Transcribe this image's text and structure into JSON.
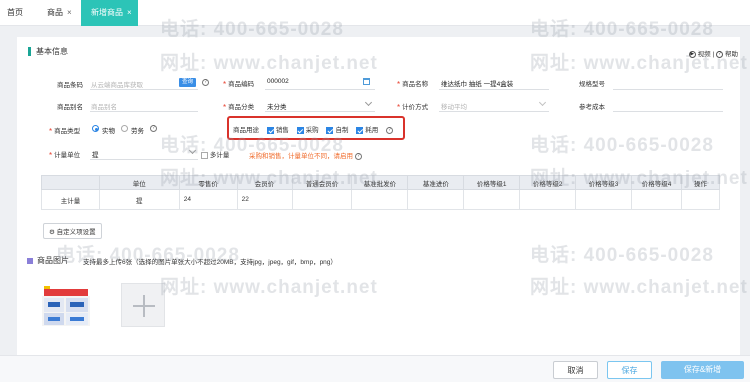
{
  "tabs": {
    "home": "首页",
    "goods": "商品",
    "new_goods": "新增商品",
    "close": "×"
  },
  "header": {
    "section_title": "基本信息",
    "video": "视频",
    "separator": "|",
    "help": "帮助"
  },
  "form": {
    "barcode_label": "商品条码",
    "barcode_placeholder": "从云端商品库获取",
    "query_button": "查询",
    "code_label": "商品编码",
    "code_value": "000002",
    "name_label": "商品名称",
    "name_value": "维达纸巾 抽纸 一提4盒装",
    "spec_label": "规格型号",
    "alias_label": "商品别名",
    "alias_placeholder": "商品别名",
    "category_label": "商品分类",
    "category_value": "未分类",
    "pricing_label": "计价方式",
    "pricing_value": "移动平均",
    "ref_cost_label": "参考成本",
    "type_label": "商品类型",
    "type_physical": "实物",
    "type_service": "劳务",
    "usage_label": "商品用途",
    "usage_options": [
      "销售",
      "采购",
      "自制",
      "耗用"
    ],
    "unit_label": "计量单位",
    "unit_value": "提",
    "multi_unit_label": "多计量",
    "warning": "采购和销售，计量单位不同，请启用"
  },
  "table": {
    "headers": [
      "",
      "单位",
      "零售价",
      "会员价",
      "普通会员价",
      "基准批发价",
      "基准进价",
      "价格等级1",
      "价格等级2",
      "价格等级3",
      "价格等级4",
      "操作"
    ],
    "rows": [
      [
        "主计量",
        "提",
        "24",
        "22",
        "",
        "",
        "",
        "",
        "",
        "",
        "",
        ""
      ]
    ]
  },
  "custom_button": "自定义项设置",
  "images": {
    "label": "商品图片",
    "hint": "支持最多上传6张（选择的图片单张大小不超过20MB，支持jpg，jpeg，gif，bmp，png）"
  },
  "footer": {
    "cancel": "取消",
    "save": "保存",
    "save_new": "保存&新增"
  },
  "watermark": {
    "phone": "电话: 400-665-0028",
    "site": "网址: www.chanjet.net"
  },
  "colors": {
    "accent": "#2cc4b7",
    "primary": "#2b85e4",
    "highlight_border": "#d9322b",
    "warning": "#f06b2b"
  }
}
